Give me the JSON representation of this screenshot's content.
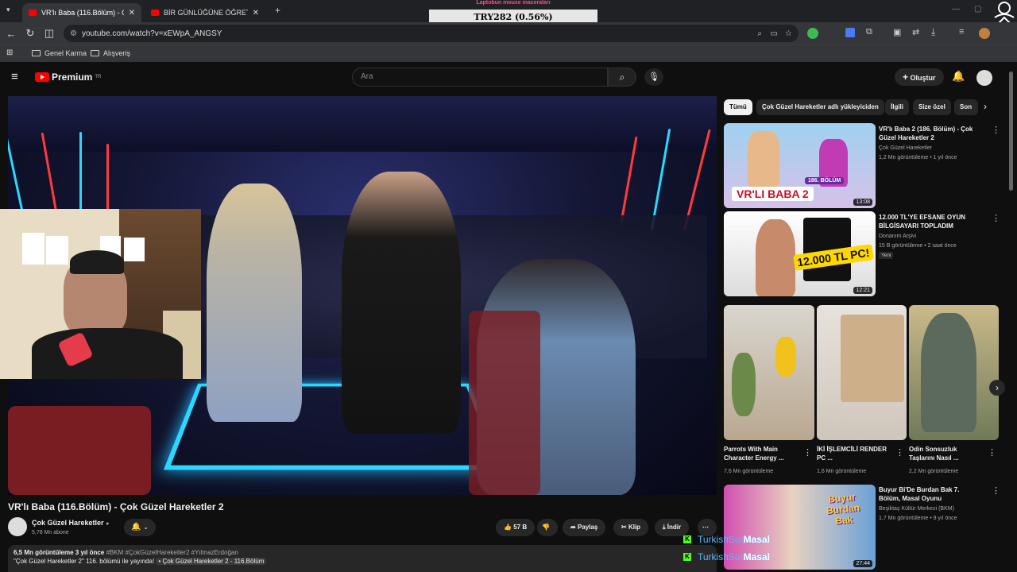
{
  "browser": {
    "tabs": [
      {
        "title": "VR'lı Baba (116.Bölüm) - Çok Gü..."
      },
      {
        "title": "BİR GÜNLÜĞÜNE ÖĞRETMEN O..."
      }
    ],
    "url": "youtube.com/watch?v=xEWpA_ANGSY",
    "bookmarks": [
      "Genel Karma",
      "Alışveriş"
    ]
  },
  "stream_overlay": {
    "title": "Laptobun mouse maceraları",
    "value": "TRY282 (0.56%)"
  },
  "header": {
    "logo_text": "Premium",
    "logo_badge": "TR",
    "search_placeholder": "Ara",
    "create_label": "Oluştur"
  },
  "video": {
    "title": "VR'lı Baba (116.Bölüm) - Çok Güzel Hareketler 2",
    "channel": "Çok Güzel Hareketler",
    "subs": "5,78 Mn abone",
    "likes": "57 B",
    "share": "Paylaş",
    "clip": "Klip",
    "download": "İndir",
    "desc_stats": "6,5 Mn görüntüleme  3 yıl önce",
    "desc_tags": "#BKM #ÇokGüzelHareketler2 #YılmazErdoğan",
    "desc_line2": "\"Çok Güzel Hareketler 2\" 116. bölümü ile yayında!",
    "desc_link": "• Çok Güzel Hareketler 2 - 116.Bölüm"
  },
  "chips": [
    "Tümü",
    "Çok Güzel Hareketler adlı yükleyiciden",
    "İlgili",
    "Size özel",
    "Son"
  ],
  "recs": [
    {
      "title": "VR'lı Baba 2 (186. Bölüm) - Çok Güzel Hareketler 2",
      "channel": "Çok Güzel Hareketler",
      "meta": "1,2 Mn görüntüleme • 1 yıl önce",
      "duration": "13:08",
      "thumb_text": "VR'LI BABA 2",
      "thumb_tag": "186. BÖLÜM"
    },
    {
      "title": "12.000 TL'YE EFSANE OYUN BİLGİSAYARI TOPLADIM",
      "channel": "Donanım Arşivi",
      "meta": "15 B görüntüleme • 2 saat önce",
      "badge": "Yeni",
      "duration": "12:21",
      "thumb_text": "12.000 TL PC!"
    }
  ],
  "shorts": [
    {
      "title": "Parrots With Main Character Energy ...",
      "meta": "7,6 Mn görüntüleme"
    },
    {
      "title": "İKİ İŞLEMCİLİ RENDER PC ...",
      "meta": "1,6 Mn görüntüleme"
    },
    {
      "title": "Odin Sonsuzluk Taşlarını Nasıl ...",
      "meta": "2,2 Mn görüntüleme"
    }
  ],
  "rec3": {
    "title": "Buyur Bi'De Burdan Bak 7. Bölüm, Masal Oyunu",
    "channel": "Beşiktaş Kültür Merkezi (BKM)",
    "meta": "1,7 Mn görüntüleme • 9 yıl önce",
    "duration": "27:44",
    "thumb_text": "Buyur Burdan Bak"
  },
  "chat": [
    {
      "user": "TurkishSusamon",
      "text": "Masal"
    },
    {
      "user": "TurkishSusamon",
      "text": "Masal"
    }
  ],
  "colors": {
    "accent": "#ff0000",
    "neon_blue": "#2ad8ff",
    "neon_red": "#ff3b3b"
  }
}
